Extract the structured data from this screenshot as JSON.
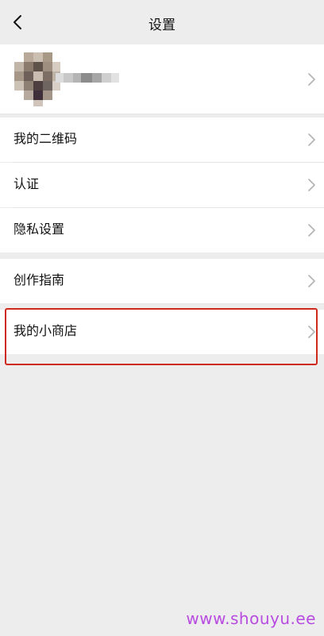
{
  "nav": {
    "title": "设置",
    "back_icon": "chevron-left-icon"
  },
  "profile": {
    "avatar": "pixelated-avatar",
    "chevron_icon": "chevron-right-icon"
  },
  "menu_group_1": [
    {
      "label": "我的二维码"
    },
    {
      "label": "认证"
    },
    {
      "label": "隐私设置"
    }
  ],
  "menu_group_2": [
    {
      "label": "创作指南"
    },
    {
      "label": "我的小商店"
    }
  ],
  "highlight": {
    "color": "#d1281c"
  },
  "watermark": "www.shouyu.ee",
  "colors": {
    "background": "#ededed",
    "row_background": "#ffffff",
    "chevron": "#b2b2b2",
    "watermark": "#b84be0"
  }
}
